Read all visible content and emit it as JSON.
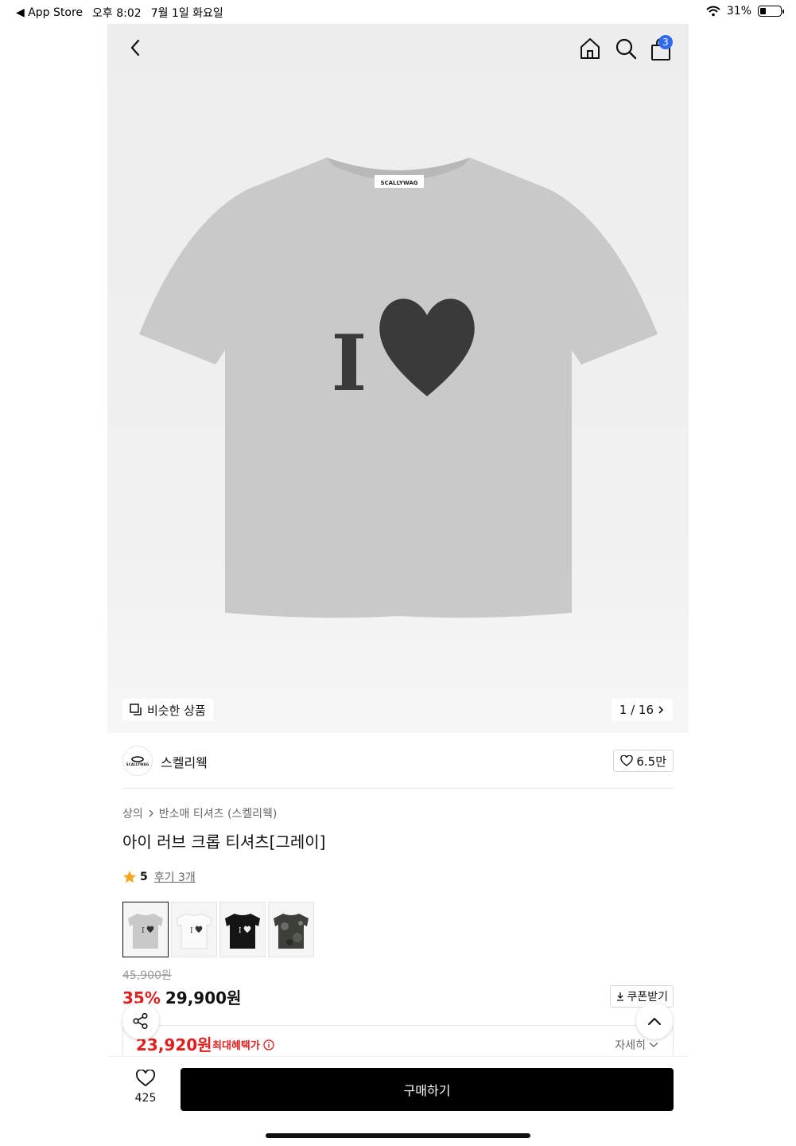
{
  "status_bar": {
    "back_app": "◀ App Store",
    "time": "오후 8:02",
    "date": "7월 1일 화요일",
    "battery": "31%",
    "battery_level": 0.31
  },
  "header": {
    "cart_count": "3"
  },
  "hero": {
    "similar_label": "비슷한 상품",
    "page": "1 / 16",
    "shirt_label": "SCALLYWAG",
    "shirt_graphic_text": "I"
  },
  "brand": {
    "logo_text": "SCALLYWAG",
    "name": "스켈리웩",
    "likes": "6.5만"
  },
  "breadcrumb": {
    "level1": "상의",
    "level2": "반소매 티셔츠 (스켈리웩)"
  },
  "product": {
    "title": "아이 러브 크롭 티셔츠[그레이]",
    "rating": "5",
    "review_link": "후기 3개",
    "original_price": "45,900원",
    "discount": "35%",
    "sale_price": "29,900원",
    "coupon_label": "쿠폰받기",
    "benefit_price": "23,920원",
    "benefit_label": "최대혜택가",
    "detail_label": "자세히"
  },
  "colors": {
    "accent_red": "#e0201f",
    "badge_blue": "#2f6bf2",
    "buy_button": "#000000"
  },
  "bottom_bar": {
    "wish_count": "425",
    "buy_label": "구매하기"
  }
}
